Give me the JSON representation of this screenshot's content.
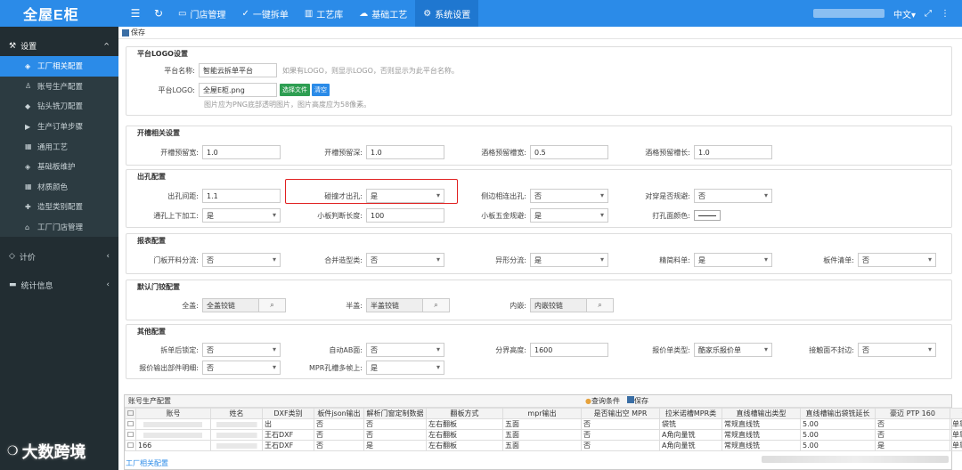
{
  "logo": {
    "text": "全屋E柜"
  },
  "nav": {
    "items": [
      {
        "label": "门店管理"
      },
      {
        "label": "一键拆单"
      },
      {
        "label": "工艺库"
      },
      {
        "label": "基础工艺"
      },
      {
        "label": "系统设置"
      }
    ],
    "lang": "中文▾"
  },
  "sidebar": {
    "settings_group": "设置",
    "items": [
      {
        "label": "工厂相关配置"
      },
      {
        "label": "账号生产配置"
      },
      {
        "label": "钻头铣刀配置"
      },
      {
        "label": "生产订单步骤"
      },
      {
        "label": "通用工艺"
      },
      {
        "label": "基础板维护"
      },
      {
        "label": "材质颜色"
      },
      {
        "label": "造型类别配置"
      },
      {
        "label": "工厂门店管理"
      }
    ],
    "pricing_group": "计价",
    "stats_group": "统计信息"
  },
  "toolbar": {
    "save": "保存"
  },
  "platform": {
    "title": "平台LOGO设置",
    "name_label": "平台名称:",
    "name_value": "智能云拆单平台",
    "name_hint": "如果有LOGO，则显示LOGO，否则显示为此平台名称。",
    "logo_label": "平台LOGO:",
    "logo_value": "全屋E柜.png",
    "choose_btn": "选择文件",
    "clear_btn": "清空",
    "logo_hint": "图片应为PNG底部透明图片，图片高度应为58像素。"
  },
  "slot": {
    "title": "开槽相关设置",
    "f1_label": "开槽预留宽:",
    "f1_value": "1.0",
    "f2_label": "开槽预留深:",
    "f2_value": "1.0",
    "f3_label": "酒格预留槽宽:",
    "f3_value": "0.5",
    "f4_label": "酒格预留槽长:",
    "f4_value": "1.0"
  },
  "hole": {
    "title": "出孔配置",
    "f1_label": "出孔间距:",
    "f1_value": "1.1",
    "f2_label": "碰撞才出孔:",
    "f2_value": "是",
    "f3_label": "侧边相连出孔:",
    "f3_value": "否",
    "f4_label": "对穿是否规避:",
    "f4_value": "否",
    "f5_label": "通孔上下加工:",
    "f5_value": "是",
    "f6_label": "小板判断长度:",
    "f6_value": "100",
    "f7_label": "小板五金规避:",
    "f7_value": "是",
    "f8_label": "打孔面颜色:"
  },
  "report": {
    "title": "报表配置",
    "f1_label": "门板开料分流:",
    "f1_value": "否",
    "f2_label": "合并造型类:",
    "f2_value": "否",
    "f3_label": "异形分流:",
    "f3_value": "是",
    "f4_label": "精简料单:",
    "f4_value": "是",
    "f5_label": "板件清单:",
    "f5_value": "否"
  },
  "hinge": {
    "title": "默认门铰配置",
    "f1_label": "全盖:",
    "f1_value": "全盖铰链",
    "f2_label": "半盖:",
    "f2_value": "半盖铰链",
    "f3_label": "内嵌:",
    "f3_value": "内嵌铰链"
  },
  "other": {
    "title": "其他配置",
    "f1_label": "拆单后锁定:",
    "f1_value": "否",
    "f2_label": "自动AB面:",
    "f2_value": "否",
    "f3_label": "分界高度:",
    "f3_value": "1600",
    "f4_label": "报价单类型:",
    "f4_value": "酷家乐报价单",
    "f5_label": "接触面不封边:",
    "f5_value": "否",
    "f6_label": "报价输出部件明细:",
    "f6_value": "否",
    "f7_label": "MPR孔槽多帧上:",
    "f7_value": "是"
  },
  "grid": {
    "title": "账号生产配置",
    "query_btn": "查询条件",
    "save_btn": "保存",
    "headers": [
      "账号",
      "姓名",
      "DXF类别",
      "板件json输出",
      "解析门窗定制数据",
      "翻板方式",
      "mpr输出",
      "是否输出空 MPR",
      "拉米诺槽MPR类",
      "直线槽输出类型",
      "直线槽输出袋铣延长",
      "豪迈 PTP 160",
      "查"
    ],
    "rows": [
      [
        "",
        "",
        "出",
        "否",
        "否",
        "左右翻板",
        "五面",
        "否",
        "袋铣",
        "常规直线铣",
        "5.00",
        "否",
        "单靠"
      ],
      [
        "",
        "",
        "王石DXF",
        "否",
        "否",
        "左右翻板",
        "五面",
        "否",
        "A角向量铣",
        "常规直线铣",
        "5.00",
        "否",
        "单靠"
      ],
      [
        "166",
        "",
        "王石DXF",
        "否",
        "是",
        "左右翻板",
        "五面",
        "否",
        "A角向量铣",
        "常规直线铣",
        "5.00",
        "是",
        "单靠"
      ]
    ]
  },
  "footer": {
    "link": "工厂相关配置"
  },
  "watermark": {
    "text": "大数跨境"
  }
}
